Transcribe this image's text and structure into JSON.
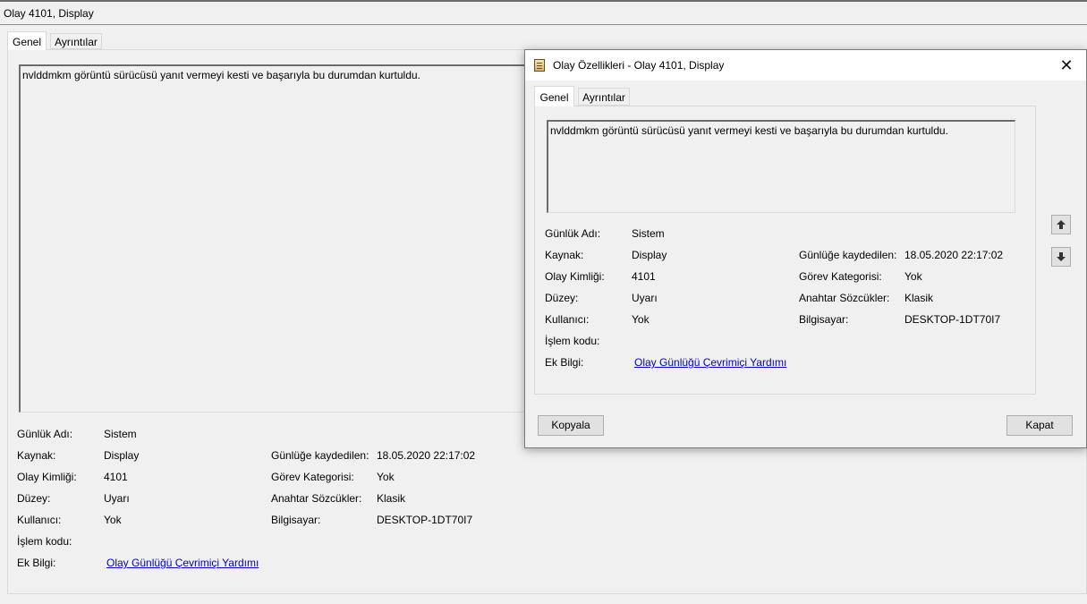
{
  "main": {
    "title": "Olay 4101, Display",
    "tabs": [
      {
        "label": "Genel"
      },
      {
        "label": "Ayrıntılar"
      }
    ],
    "description": "nvlddmkm görüntü sürücüsü yanıt vermeyi kesti ve başarıyla bu durumdan kurtuldu.",
    "fields": {
      "log_name_label": "Günlük Adı:",
      "log_name_value": "Sistem",
      "source_label": "Kaynak:",
      "source_value": "Display",
      "event_id_label": "Olay Kimliği:",
      "event_id_value": "4101",
      "level_label": "Düzey:",
      "level_value": "Uyarı",
      "user_label": "Kullanıcı:",
      "user_value": "Yok",
      "opcode_label": "İşlem kodu:",
      "more_info_label": "Ek Bilgi:",
      "more_info_link": "Olay Günlüğü Çevrimiçi Yardımı",
      "logged_label": "Günlüğe kaydedilen:",
      "logged_value": "18.05.2020 22:17:02",
      "task_category_label": "Görev Kategorisi:",
      "task_category_value": "Yok",
      "keywords_label": "Anahtar Sözcükler:",
      "keywords_value": "Klasik",
      "computer_label": "Bilgisayar:",
      "computer_value": "DESKTOP-1DT70I7"
    }
  },
  "dialog": {
    "title": "Olay Özellikleri - Olay 4101, Display",
    "close_glyph": "✕",
    "tabs": [
      {
        "label": "Genel"
      },
      {
        "label": "Ayrıntılar"
      }
    ],
    "description": "nvlddmkm görüntü sürücüsü yanıt vermeyi kesti ve başarıyla bu durumdan kurtuldu.",
    "fields": {
      "log_name_label": "Günlük Adı:",
      "log_name_value": "Sistem",
      "source_label": "Kaynak:",
      "source_value": "Display",
      "event_id_label": "Olay Kimliği:",
      "event_id_value": "4101",
      "level_label": "Düzey:",
      "level_value": "Uyarı",
      "user_label": "Kullanıcı:",
      "user_value": "Yok",
      "opcode_label": "İşlem kodu:",
      "more_info_label": "Ek Bilgi:",
      "more_info_link": "Olay Günlüğü Çevrimiçi Yardımı",
      "logged_label": "Günlüğe kaydedilen:",
      "logged_value": "18.05.2020 22:17:02",
      "task_category_label": "Görev Kategorisi:",
      "task_category_value": "Yok",
      "keywords_label": "Anahtar Sözcükler:",
      "keywords_value": "Klasik",
      "computer_label": "Bilgisayar:",
      "computer_value": "DESKTOP-1DT70I7"
    },
    "icons": {
      "title": "event-properties-icon",
      "up": "up-arrow-icon",
      "down": "down-arrow-icon"
    },
    "buttons": {
      "copy": "Kopyala",
      "close": "Kapat"
    }
  },
  "colors": {
    "link": "#0000cc",
    "background": "#f0f0f0",
    "title_bar": "#ffffff"
  }
}
